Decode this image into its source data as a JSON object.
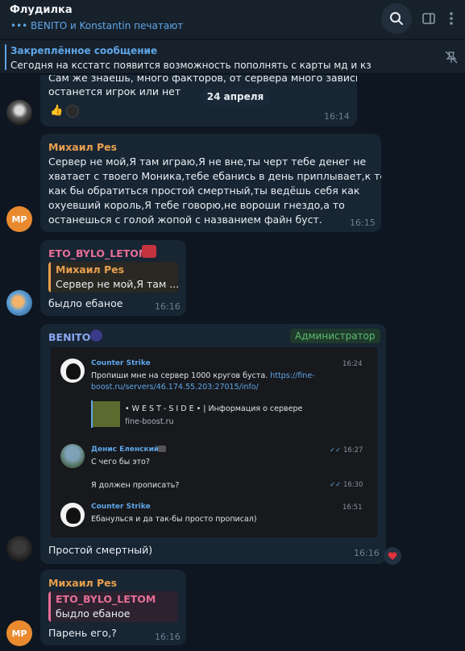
{
  "header": {
    "title": "Флудилка",
    "status": "••• BENITO и Konstantin печатают"
  },
  "pinned": {
    "title": "Закреплённое сообщение",
    "text": "Сегодня на ксстатс появится возможность пополнять с карты мд и кз"
  },
  "date_pill": "24 апреля",
  "messages": {
    "m1": {
      "lines": [
        "Сам же знаешь, много факторов, от сервера много зависит",
        "останется игрок или нет"
      ],
      "time": "16:14"
    },
    "m2": {
      "sender": "Михаил Pes",
      "avatar": "MP",
      "lines": [
        "Сервер не мой,Я там играю,Я не вне,ты черт тебе денег не",
        "хватает с твоего Моника,тебе ебанись в день приплывает,к тебе",
        "как бы обратиться простой смертный,ты ведёшь себя как",
        "охуевший король,Я тебе говорю,не вороши гнездо,а то",
        "останешься с голой жопой с названием файн буст."
      ],
      "time": "16:15"
    },
    "m3": {
      "sender": "ETO_BYLO_LETOM",
      "reply_name": "Михаил Pes",
      "reply_text": "Сервер не мой,Я там ...",
      "text": "быдло ебаное",
      "time": "16:16"
    },
    "m4": {
      "sender": "BENITO",
      "badge": "Администратор",
      "text": "Простой смертный)",
      "time": "16:16",
      "screenshot": {
        "msg1_name": "Counter Strike",
        "msg1_line1": "Пропиши мне на сервер 1000 кругов буста. ",
        "msg1_link1": "https://fine-",
        "msg1_link2": "boost.ru/servers/46.174.55.203:27015/info/",
        "msg1_time": "16:24",
        "preview_title": "• W E S T - S I D E • | Информация о сервере",
        "preview_site": "fine-boost.ru",
        "msg2_name": "Денис Еленский",
        "msg2_text": "С чего бы это?",
        "msg2_time": "16:27",
        "msg3_text": "Я должен прописать?",
        "msg3_time": "16:30",
        "msg4_name": "Counter Strike",
        "msg4_text": "Ебанулься и да так-бы просто прописал)",
        "msg4_time": "16:51"
      }
    },
    "m5": {
      "sender": "Михаил Pes",
      "avatar": "MP",
      "reply_name": "ETO_BYLO_LETOM",
      "reply_text": "быдло ебаное",
      "text": "Парень его,?",
      "time": "16:16"
    }
  },
  "colors": {
    "background": "#0e1621",
    "bubble": "#182533",
    "accent": "#5fa6e8",
    "sender_orange": "#e8a04e",
    "sender_pink": "#e56e96",
    "sender_blue": "#8aa7f0",
    "admin_green": "#5cbd6f"
  },
  "icons": [
    "search-icon",
    "sidebar-icon",
    "more-icon",
    "unpin-icon",
    "heart-icon",
    "thumbs-up-icon"
  ]
}
